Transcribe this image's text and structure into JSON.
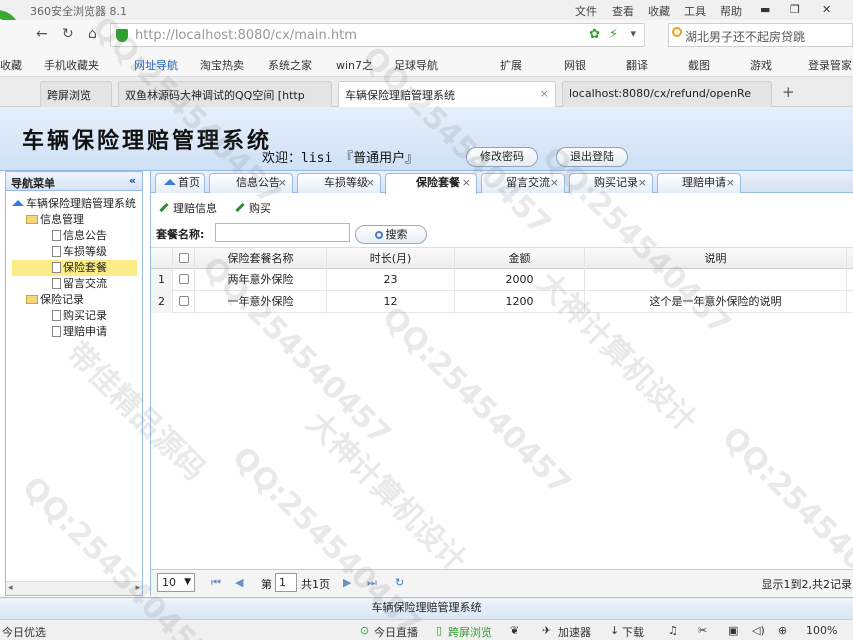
{
  "browser": {
    "title": "360安全浏览器 8.1",
    "menus": [
      "文件",
      "查看",
      "收藏",
      "工具",
      "帮助"
    ],
    "url_host": "http://localhost",
    "url_path": ":8080/cx/main.htm",
    "search_text": "湖北男子还不起房贷跳",
    "bookmarks": [
      "收藏",
      "手机收藏夹",
      "网址导航",
      "淘宝热卖",
      "系统之家",
      "win7之",
      "足球导航",
      "扩展",
      "网银",
      "翻译",
      "截图",
      "游戏",
      "登录管家"
    ],
    "tabs": [
      "跨屏浏览",
      "双鱼林源码大神调试的QQ空间 [http",
      "车辆保险理赔管理系统",
      "localhost:8080/cx/refund/openRe"
    ]
  },
  "app": {
    "system_name": "车辆保险理赔管理系统",
    "welcome": "欢迎：lisi 『普通用户』",
    "change_pwd": "修改密码",
    "logout": "退出登陆",
    "footer": "车辆保险理赔管理系统"
  },
  "nav": {
    "title": "导航菜单",
    "collapse": "«",
    "root": "车辆保险理赔管理系统",
    "group1": "信息管理",
    "items1": [
      "信息公告",
      "车损等级",
      "保险套餐",
      "留言交流"
    ],
    "group2": "保险记录",
    "items2": [
      "购买记录",
      "理赔申请"
    ]
  },
  "tabs": {
    "home": "首页",
    "t1": "信息公告",
    "t2": "车损等级",
    "t3": "保险套餐",
    "t4": "留言交流",
    "t5": "购买记录",
    "t6": "理赔申请",
    "close": "×"
  },
  "toolbar": {
    "claim": "理赔信息",
    "buy": "购买"
  },
  "query": {
    "label": "套餐名称:",
    "search": "搜索"
  },
  "grid": {
    "columns": [
      "保险套餐名称",
      "时长(月)",
      "金额",
      "说明"
    ],
    "rows": [
      {
        "no": "1",
        "name": "两年意外保险",
        "months": "23",
        "amount": "2000",
        "desc": ""
      },
      {
        "no": "2",
        "name": "一年意外保险",
        "months": "12",
        "amount": "1200",
        "desc": "这个是一年意外保险的说明"
      }
    ]
  },
  "pager": {
    "size": "10",
    "page_prefix": "第",
    "page": "1",
    "page_suffix": "共1页",
    "info": "显示1到2,共2记录"
  },
  "statusbar": {
    "left": "今日优选",
    "items": [
      "今日直播",
      "跨屏浏览",
      "加速器",
      "下载",
      "100%"
    ]
  },
  "watermark": {
    "texts": [
      "QQ:254540457",
      "大神计算机设计",
      "带佳精品源码"
    ]
  }
}
